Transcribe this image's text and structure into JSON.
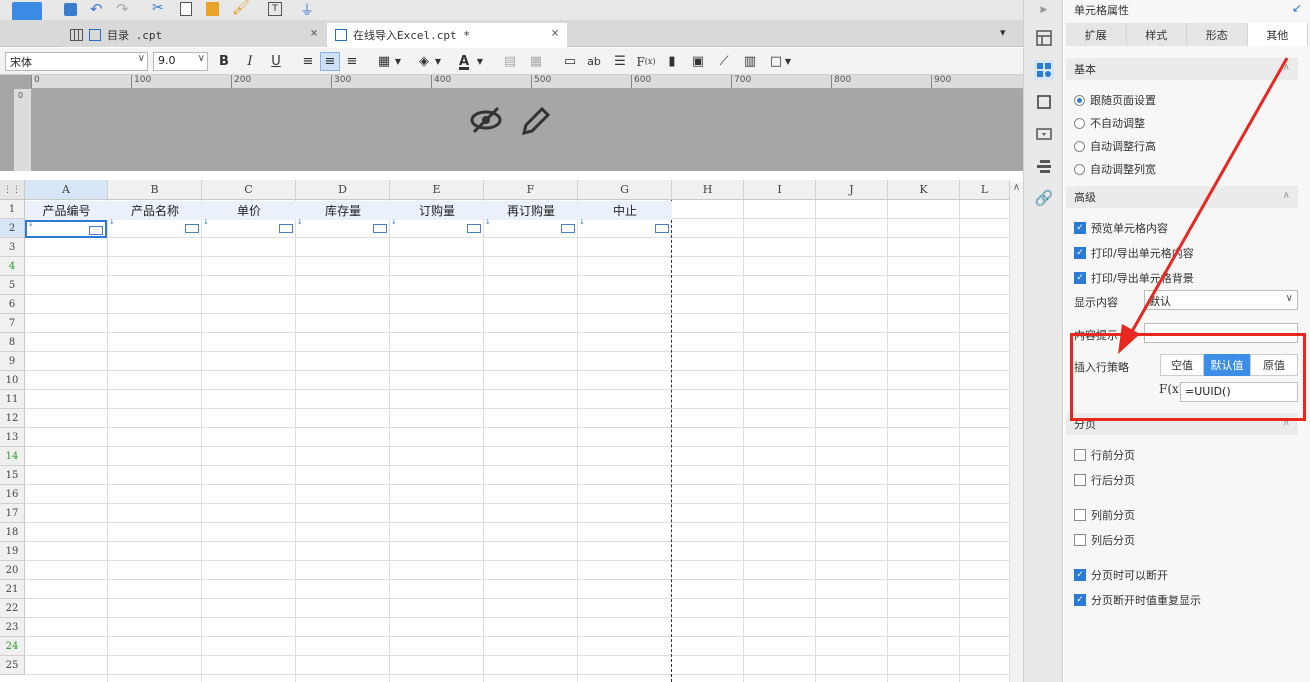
{
  "tabs": [
    {
      "label": "目录 .cpt"
    },
    {
      "label": "在线导入Excel.cpt *"
    }
  ],
  "format_bar": {
    "font_family": "宋体",
    "font_size": "9.0"
  },
  "ruler": {
    "ticks": [
      "0",
      "100",
      "200",
      "300",
      "400",
      "500",
      "600",
      "700",
      "800",
      "900"
    ],
    "vertical_tick": "0"
  },
  "sheet": {
    "columns": [
      "A",
      "B",
      "C",
      "D",
      "E",
      "F",
      "G",
      "H",
      "I",
      "J",
      "K",
      "L"
    ],
    "rows": [
      "1",
      "2",
      "3",
      "4",
      "5",
      "6",
      "7",
      "8",
      "9",
      "10",
      "11",
      "12",
      "13",
      "14",
      "15",
      "16",
      "17",
      "18",
      "19",
      "20",
      "21",
      "22",
      "23",
      "24",
      "25"
    ],
    "header_row": [
      "产品编号",
      "产品名称",
      "单价",
      "库存量",
      "订购量",
      "再订购量",
      "中止"
    ]
  },
  "panel": {
    "title": "单元格属性",
    "tabs": [
      "扩展",
      "样式",
      "形态",
      "其他"
    ],
    "active_tab": "其他",
    "basic_section": "基本",
    "basic_options": [
      "跟随页面设置",
      "不自动调整",
      "自动调整行高",
      "自动调整列宽"
    ],
    "advanced_section": "高级",
    "advanced_checks": [
      "预览单元格内容",
      "打印/导出单元格内容",
      "打印/导出单元格背景"
    ],
    "display_label": "显示内容",
    "display_value": "默认",
    "hint_label": "内容提示",
    "insert_label": "插入行策略",
    "insert_options": [
      "空值",
      "默认值",
      "原值"
    ],
    "insert_active": "默认值",
    "formula_icon_label": "F(x)",
    "formula_value": "=UUID()",
    "paging_section": "分页",
    "paging_checks": [
      "行前分页",
      "行后分页",
      "列前分页",
      "列后分页"
    ],
    "paging_checks2": [
      "分页时可以断开",
      "分页断开时值重复显示"
    ]
  },
  "colors": {
    "accent": "#3d8ee6",
    "highlight_border": "#e8271f"
  }
}
